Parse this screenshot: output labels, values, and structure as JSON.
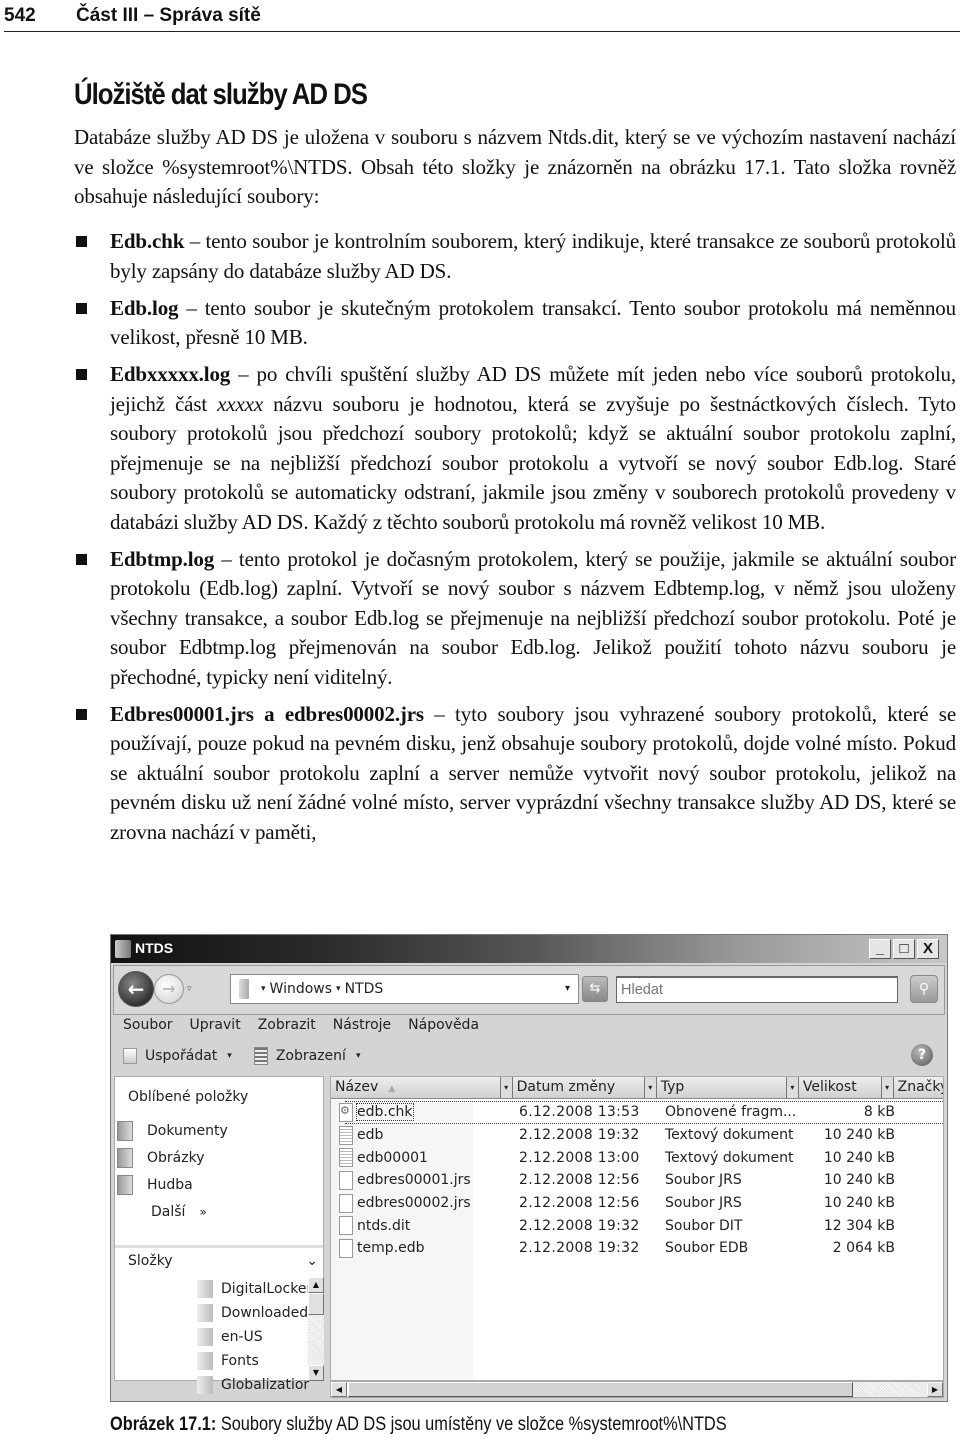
{
  "running_header": {
    "page_number": "542",
    "part_title": "Část III – Správa sítě"
  },
  "section": {
    "heading": "Úložiště dat služby AD DS",
    "intro": "Databáze služby AD DS je uložena v souboru s názvem Ntds.dit, který se ve výchozím nastavení nachází ve složce %systemroot%\\NTDS. Obsah této složky je znázorněn na obrázku 17.1. Tato složka rovněž obsahuje následující soubory:",
    "bullets": [
      {
        "term": "Edb.chk",
        "text": " – tento soubor je kontrolním souborem, který indikuje, které transakce ze souborů protokolů byly zapsány do databáze služby AD DS."
      },
      {
        "term": "Edb.log",
        "text": " – tento soubor je skutečným protokolem transakcí. Tento soubor protokolu má neměnnou velikost, přesně 10 MB."
      },
      {
        "term": "Edbxxxxx.log",
        "text_before": " – po chvíli spuštění služby AD DS můžete mít jeden nebo více souborů protokolu, jejichž část ",
        "italic": "xxxxx",
        "text_after": " názvu souboru je hodnotou, která se zvyšuje po šestnáctkových číslech. Tyto soubory protokolů jsou předchozí soubory protokolů; když se aktuální soubor protokolu zaplní, přejmenuje se na nejbližší předchozí soubor protokolu a vytvoří se nový soubor Edb.log. Staré soubory protokolů se automaticky odstraní, jakmile jsou změny v souborech protokolů provedeny v databázi služby AD DS. Každý z těchto souborů protokolu má rovněž velikost 10 MB."
      },
      {
        "term": "Edbtmp.log",
        "text": " – tento protokol je dočasným protokolem, který se použije, jakmile se aktuální soubor protokolu (Edb.log) zaplní. Vytvoří se nový soubor s názvem Edbtemp.log, v němž jsou uloženy všechny transakce, a soubor Edb.log se přejmenuje na nejbližší předchozí soubor protokolu. Poté je soubor Edbtmp.log přejmenován na soubor Edb.log. Jelikož použití tohoto názvu souboru je přechodné, typicky není viditelný."
      },
      {
        "term": "Edbres00001.jrs a edbres00002.jrs",
        "text": " – tyto soubory jsou vyhrazené soubory protokolů, které se používají, pouze pokud na pevném disku, jenž obsahuje soubory protokolů, dojde volné místo. Pokud se aktuální soubor protokolu zaplní a server nemůže vytvořit nový soubor protokolu, jelikož na pevném disku už není žádné volné místo, server vyprázdní všechny transakce služby AD DS, které se zrovna nachází v paměti,"
      }
    ]
  },
  "explorer": {
    "title": "NTDS",
    "window_buttons": {
      "minimize": "_",
      "maximize": "□",
      "close": "X"
    },
    "nav": {
      "back": "←",
      "forward": "→",
      "history_dropdown": "▿"
    },
    "address": {
      "crumbs": [
        "Windows",
        "NTDS"
      ],
      "separator": "▾",
      "dropdown": "▾"
    },
    "refresh": "⇆",
    "search": {
      "placeholder": "Hledat",
      "button": "⚲"
    },
    "menu": [
      "Soubor",
      "Upravit",
      "Zobrazit",
      "Nástroje",
      "Nápověda"
    ],
    "commands": [
      {
        "label": "Uspořádat",
        "icon": "organize-icon"
      },
      {
        "label": "Zobrazení",
        "icon": "views-icon"
      }
    ],
    "command_dropdown": "▾",
    "help": "?",
    "favorites": {
      "title": "Oblíbené položky",
      "items": [
        "Dokumenty",
        "Obrázky",
        "Hudba"
      ],
      "more": {
        "label": "Další",
        "chevron": "»"
      }
    },
    "folders": {
      "title": "Složky",
      "chevron": "⌄",
      "items": [
        "DigitalLocker",
        "Downloaded",
        "en-US",
        "Fonts",
        "Globalization"
      ]
    },
    "scroll_arrows": {
      "up": "▲",
      "down": "▼",
      "left": "◀",
      "right": "▶"
    },
    "columns": [
      {
        "label": "Název",
        "sort": "▲"
      },
      {
        "label": "Datum změny"
      },
      {
        "label": "Typ"
      },
      {
        "label": "Velikost"
      },
      {
        "label": "Značky"
      }
    ],
    "column_dropdown": "▾",
    "files": [
      {
        "name": "edb.chk",
        "date": "6.12.2008 13:53",
        "type": "Obnovené fragm...",
        "size": "8 kB",
        "icon": "chk"
      },
      {
        "name": "edb",
        "date": "2.12.2008 19:32",
        "type": "Textový dokument",
        "size": "10 240 kB",
        "icon": "text"
      },
      {
        "name": "edb00001",
        "date": "2.12.2008 13:00",
        "type": "Textový dokument",
        "size": "10 240 kB",
        "icon": "text"
      },
      {
        "name": "edbres00001.jrs",
        "date": "2.12.2008 12:56",
        "type": "Soubor JRS",
        "size": "10 240 kB",
        "icon": "blank"
      },
      {
        "name": "edbres00002.jrs",
        "date": "2.12.2008 12:56",
        "type": "Soubor JRS",
        "size": "10 240 kB",
        "icon": "blank"
      },
      {
        "name": "ntds.dit",
        "date": "2.12.2008 19:32",
        "type": "Soubor DIT",
        "size": "12 304 kB",
        "icon": "blank"
      },
      {
        "name": "temp.edb",
        "date": "2.12.2008 19:32",
        "type": "Soubor EDB",
        "size": "2 064 kB",
        "icon": "blank"
      }
    ]
  },
  "caption": {
    "label": "Obrázek 17.1:",
    "text": " Soubory služby AD DS jsou umístěny ve složce %systemroot%\\NTDS"
  }
}
